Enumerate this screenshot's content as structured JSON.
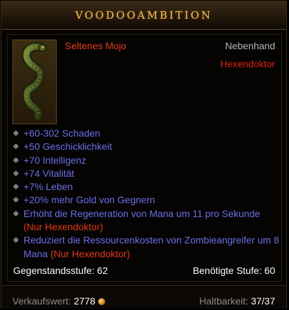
{
  "title": "VOODOOAMBITION",
  "item": {
    "rarity_type": "Seltenes Mojo",
    "slot": "Nebenhand",
    "class_restriction": "Hexendoktor",
    "icon": "snake-mojo-icon"
  },
  "affixes": [
    {
      "text": "+60-302 Schaden"
    },
    {
      "text": "+50 Geschicklichkeit"
    },
    {
      "text": "+70 Intelligenz"
    },
    {
      "text": "+74 Vitalität"
    },
    {
      "text": "+7% Leben"
    },
    {
      "text": "+20% mehr Gold von Gegnern"
    },
    {
      "text": "Erhöht die Regeneration von Mana um 11 pro Sekunde",
      "req": "(Nur Hexendoktor)"
    },
    {
      "text": "Reduziert die Ressourcenkosten von Zombieangreifer um 8 Mana",
      "req": "(Nur Hexendoktor)"
    }
  ],
  "stats": {
    "item_level": "Gegenstandsstufe: 62",
    "required_level": "Benötigte Stufe: 60"
  },
  "footer": {
    "sell_label": "Verkaufswert:",
    "sell_value": "2778",
    "durability_label": "Haltbarkeit:",
    "durability_value": "37/37"
  },
  "colors": {
    "title": "#f0c060",
    "affix": "#6d6ee8",
    "requirement": "#e63a16",
    "rarity": "#e73a1a"
  }
}
